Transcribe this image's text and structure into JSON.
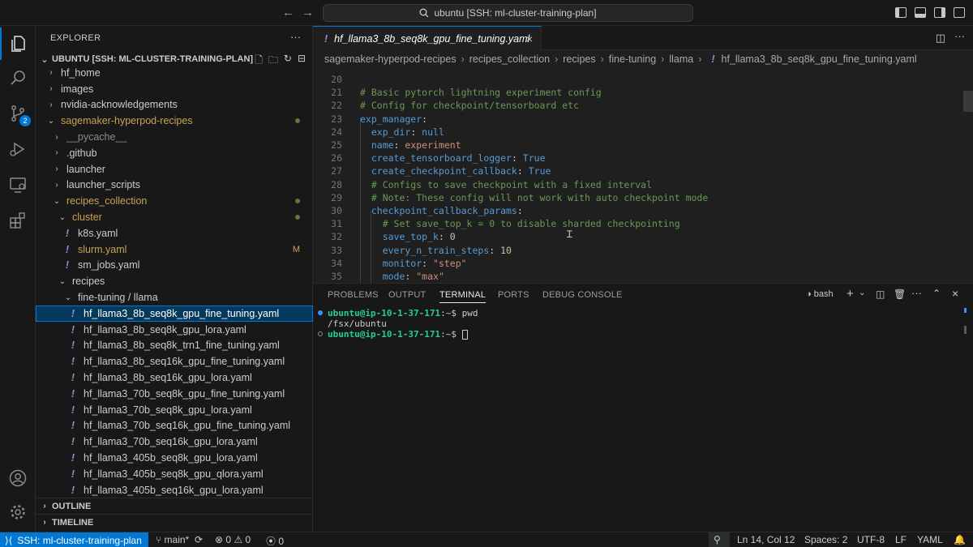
{
  "titlebar": {
    "search_text": "ubuntu [SSH: ml-cluster-training-plan]"
  },
  "activity": {
    "scm_badge": "2"
  },
  "sidebar": {
    "title": "EXPLORER",
    "workspace": "UBUNTU [SSH: ML-CLUSTER-TRAINING-PLAN]",
    "tree": [
      {
        "label": "hf_home",
        "type": "folder",
        "indent": 1,
        "open": false
      },
      {
        "label": "images",
        "type": "folder",
        "indent": 1,
        "open": false
      },
      {
        "label": "nvidia-acknowledgements",
        "type": "folder",
        "indent": 1,
        "open": false
      },
      {
        "label": "sagemaker-hyperpod-recipes",
        "type": "folder",
        "indent": 1,
        "open": true,
        "color": "mod",
        "dot": true
      },
      {
        "label": "__pycache__",
        "type": "folder",
        "indent": 2,
        "open": false,
        "color": "muted"
      },
      {
        "label": ".github",
        "type": "folder",
        "indent": 2,
        "open": false
      },
      {
        "label": "launcher",
        "type": "folder",
        "indent": 2,
        "open": false
      },
      {
        "label": "launcher_scripts",
        "type": "folder",
        "indent": 2,
        "open": false
      },
      {
        "label": "recipes_collection",
        "type": "folder",
        "indent": 2,
        "open": true,
        "color": "mod",
        "dot": true
      },
      {
        "label": "cluster",
        "type": "folder",
        "indent": 3,
        "open": true,
        "color": "mod",
        "dot": true
      },
      {
        "label": "k8s.yaml",
        "type": "file",
        "indent": 4
      },
      {
        "label": "slurm.yaml",
        "type": "file",
        "indent": 4,
        "color": "mod",
        "deco": "M"
      },
      {
        "label": "sm_jobs.yaml",
        "type": "file",
        "indent": 4
      },
      {
        "label": "recipes",
        "type": "folder",
        "indent": 3,
        "open": true
      },
      {
        "label": "fine-tuning / llama",
        "type": "folder",
        "indent": 4,
        "open": true
      },
      {
        "label": "hf_llama3_8b_seq8k_gpu_fine_tuning.yaml",
        "type": "file",
        "indent": 5,
        "selected": true
      },
      {
        "label": "hf_llama3_8b_seq8k_gpu_lora.yaml",
        "type": "file",
        "indent": 5
      },
      {
        "label": "hf_llama3_8b_seq8k_trn1_fine_tuning.yaml",
        "type": "file",
        "indent": 5
      },
      {
        "label": "hf_llama3_8b_seq16k_gpu_fine_tuning.yaml",
        "type": "file",
        "indent": 5
      },
      {
        "label": "hf_llama3_8b_seq16k_gpu_lora.yaml",
        "type": "file",
        "indent": 5
      },
      {
        "label": "hf_llama3_70b_seq8k_gpu_fine_tuning.yaml",
        "type": "file",
        "indent": 5
      },
      {
        "label": "hf_llama3_70b_seq8k_gpu_lora.yaml",
        "type": "file",
        "indent": 5
      },
      {
        "label": "hf_llama3_70b_seq16k_gpu_fine_tuning.yaml",
        "type": "file",
        "indent": 5
      },
      {
        "label": "hf_llama3_70b_seq16k_gpu_lora.yaml",
        "type": "file",
        "indent": 5
      },
      {
        "label": "hf_llama3_405b_seq8k_gpu_lora.yaml",
        "type": "file",
        "indent": 5
      },
      {
        "label": "hf_llama3_405b_seq8k_gpu_qlora.yaml",
        "type": "file",
        "indent": 5
      },
      {
        "label": "hf_llama3_405b_seq16k_gpu_lora.yaml",
        "type": "file",
        "indent": 5
      }
    ],
    "outline_label": "OUTLINE",
    "timeline_label": "TIMELINE"
  },
  "editor": {
    "tab_title": "hf_llama3_8b_seq8k_gpu_fine_tuning.yaml",
    "breadcrumb": [
      "sagemaker-hyperpod-recipes",
      "recipes_collection",
      "recipes",
      "fine-tuning",
      "llama",
      "hf_llama3_8b_seq8k_gpu_fine_tuning.yaml"
    ],
    "lines": [
      {
        "n": "20",
        "parts": []
      },
      {
        "n": "21",
        "parts": [
          {
            "t": "# Basic pytorch lightning experiment config",
            "c": "c"
          }
        ]
      },
      {
        "n": "22",
        "parts": [
          {
            "t": "# Config for checkpoint/tensorboard etc",
            "c": "c"
          }
        ]
      },
      {
        "n": "23",
        "parts": [
          {
            "t": "exp_manager",
            "c": "k"
          },
          {
            "t": ":",
            "c": "p"
          }
        ]
      },
      {
        "n": "24",
        "parts": [
          {
            "t": "  exp_dir",
            "c": "k"
          },
          {
            "t": ": ",
            "c": "p"
          },
          {
            "t": "null",
            "c": "v"
          }
        ]
      },
      {
        "n": "25",
        "parts": [
          {
            "t": "  name",
            "c": "k"
          },
          {
            "t": ": ",
            "c": "p"
          },
          {
            "t": "experiment",
            "c": "s"
          }
        ]
      },
      {
        "n": "26",
        "parts": [
          {
            "t": "  create_tensorboard_logger",
            "c": "k"
          },
          {
            "t": ": ",
            "c": "p"
          },
          {
            "t": "True",
            "c": "v"
          }
        ]
      },
      {
        "n": "27",
        "parts": [
          {
            "t": "  create_checkpoint_callback",
            "c": "k"
          },
          {
            "t": ": ",
            "c": "p"
          },
          {
            "t": "True",
            "c": "v"
          }
        ]
      },
      {
        "n": "28",
        "parts": [
          {
            "t": "  # Configs to save checkpoint with a fixed interval",
            "c": "c"
          }
        ]
      },
      {
        "n": "29",
        "parts": [
          {
            "t": "  # Note: These config will not work with auto checkpoint mode",
            "c": "c"
          }
        ]
      },
      {
        "n": "30",
        "parts": [
          {
            "t": "  checkpoint_callback_params",
            "c": "k"
          },
          {
            "t": ":",
            "c": "p"
          }
        ]
      },
      {
        "n": "31",
        "parts": [
          {
            "t": "    # Set save_top_k = 0 to disable sharded checkpointing",
            "c": "c"
          }
        ]
      },
      {
        "n": "32",
        "parts": [
          {
            "t": "    save_top_k",
            "c": "k"
          },
          {
            "t": ": ",
            "c": "p"
          },
          {
            "t": "0",
            "c": "n"
          }
        ]
      },
      {
        "n": "33",
        "parts": [
          {
            "t": "    every_n_train_steps",
            "c": "k"
          },
          {
            "t": ": ",
            "c": "p"
          },
          {
            "t": "10",
            "c": "n"
          }
        ]
      },
      {
        "n": "34",
        "parts": [
          {
            "t": "    monitor",
            "c": "k"
          },
          {
            "t": ": ",
            "c": "p"
          },
          {
            "t": "\"step\"",
            "c": "s"
          }
        ]
      },
      {
        "n": "35",
        "parts": [
          {
            "t": "    mode",
            "c": "k"
          },
          {
            "t": ": ",
            "c": "p"
          },
          {
            "t": "\"max\"",
            "c": "s"
          }
        ]
      }
    ]
  },
  "panel": {
    "tabs": [
      "PROBLEMS",
      "OUTPUT",
      "TERMINAL",
      "PORTS",
      "DEBUG CONSOLE"
    ],
    "active_tab": "TERMINAL",
    "shell": "bash",
    "terminal": {
      "prompt": "ubuntu@ip-10-1-37-171",
      "prompt_suffix": ":~$ ",
      "command": "pwd",
      "output": "/fsx/ubuntu"
    }
  },
  "status": {
    "remote": "SSH: ml-cluster-training-plan",
    "branch": "main*",
    "errors": "0",
    "warnings": "0",
    "ports": "0",
    "position": "Ln 14, Col 12",
    "spaces": "Spaces: 2",
    "encoding": "UTF-8",
    "eol": "LF",
    "language": "YAML"
  }
}
